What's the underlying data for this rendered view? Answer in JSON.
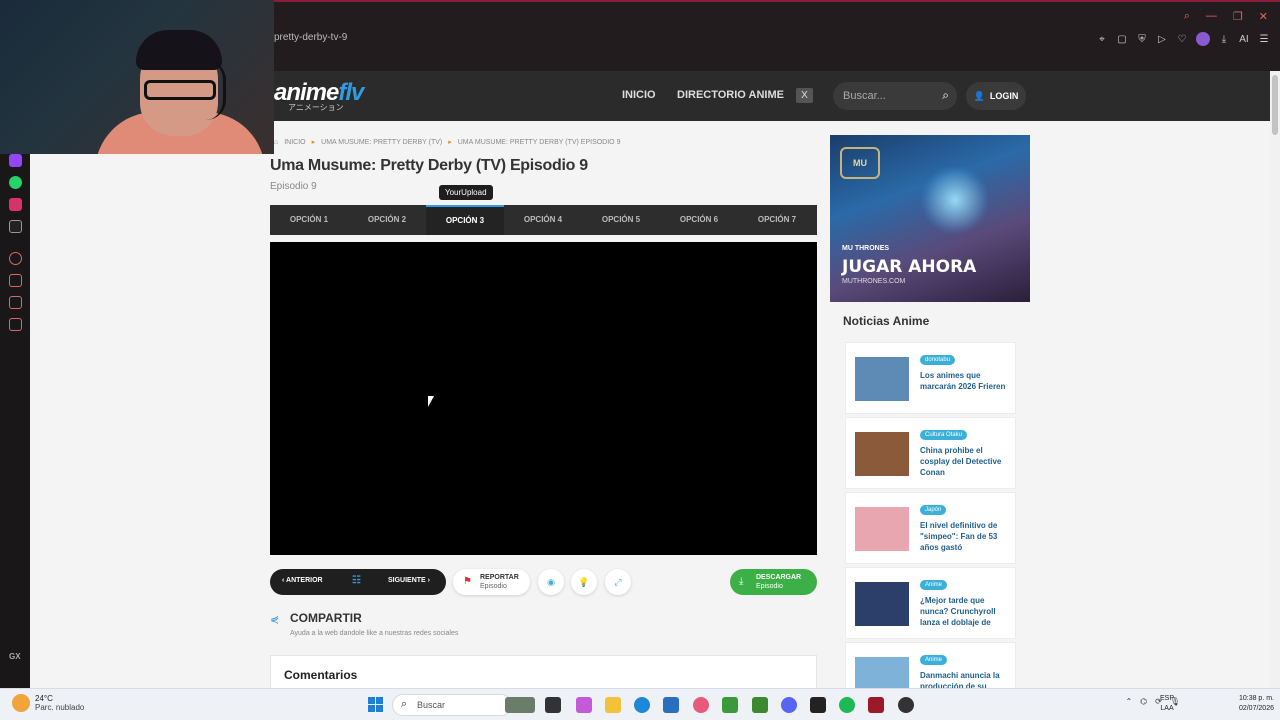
{
  "browser": {
    "url": "pretty-derby-tv-9",
    "window_controls": [
      "search-icon",
      "minimize-icon",
      "restore-icon",
      "close-icon"
    ],
    "toolbar_icons": [
      "pin-icon",
      "screenshot-icon",
      "shield-icon",
      "play-icon",
      "heart-icon",
      "profile-icon",
      "download-icon",
      "ai-icon",
      "menu-icon"
    ],
    "ai_label": "AI"
  },
  "site": {
    "logo_main": "anime",
    "logo_accent": "flv",
    "logo_sub": "アニメーション",
    "nav": {
      "inicio": "INICIO",
      "directorio": "DIRECTORIO ANIME"
    },
    "x_icon": "X",
    "search_placeholder": "Buscar...",
    "login": "LOGIN"
  },
  "breadcrumb": [
    "INICIO",
    "UMA MUSUME: PRETTY DERBY (TV)",
    "UMA MUSUME: PRETTY DERBY (TV) EPISODIO 9"
  ],
  "episode": {
    "title": "Uma Musume: Pretty Derby (TV) Episodio 9",
    "subtitle": "Episodio 9",
    "tooltip": "YourUpload"
  },
  "options": [
    "OPCIÓN 1",
    "OPCIÓN 2",
    "OPCIÓN 3",
    "OPCIÓN 4",
    "OPCIÓN 5",
    "OPCIÓN 6",
    "OPCIÓN 7"
  ],
  "active_option": 2,
  "controls": {
    "prev": "ANTERIOR",
    "next": "SIGUIENTE",
    "report_l1": "REPORTAR",
    "report_l2": "Episodio",
    "download_l1": "DESCARGAR",
    "download_l2": "Episodio"
  },
  "share": {
    "title": "COMPARTIR",
    "subtitle": "Ayuda a la web dandole like a nuestras redes sociales"
  },
  "comments": {
    "title": "Comentarios"
  },
  "ad": {
    "badge": "MU",
    "brand": "MU THRONES",
    "cta": "JUGAR AHORA",
    "site": "MUTHRONES.COM"
  },
  "news": {
    "title": "Noticias Anime",
    "items": [
      {
        "tag": "donotabu",
        "text": "Los animes que marcarán 2026 Frieren",
        "thumb_color": "#5d8bb5"
      },
      {
        "tag": "Cultura Otaku",
        "text": "China prohibe el cosplay del Detective Conan",
        "thumb_color": "#8a5a3a"
      },
      {
        "tag": "Japón",
        "text": "El nivel definitivo de \"simpeo\": Fan de 53 años gastó",
        "thumb_color": "#e8a6b0"
      },
      {
        "tag": "Anime",
        "text": "¿Mejor tarde que nunca? Crunchyroll lanza el doblaje de",
        "thumb_color": "#2b3f6a"
      },
      {
        "tag": "Anime",
        "text": "Danmachi anuncia la producción de su",
        "thumb_color": "#7fb2d8"
      }
    ]
  },
  "taskbar": {
    "temp": "24°C",
    "weather": "Parc. nublado",
    "search": "Buscar",
    "lang1": "ESP",
    "lang2": "LAA",
    "time": "10:38 p. m.",
    "date": "02/07/2026"
  }
}
